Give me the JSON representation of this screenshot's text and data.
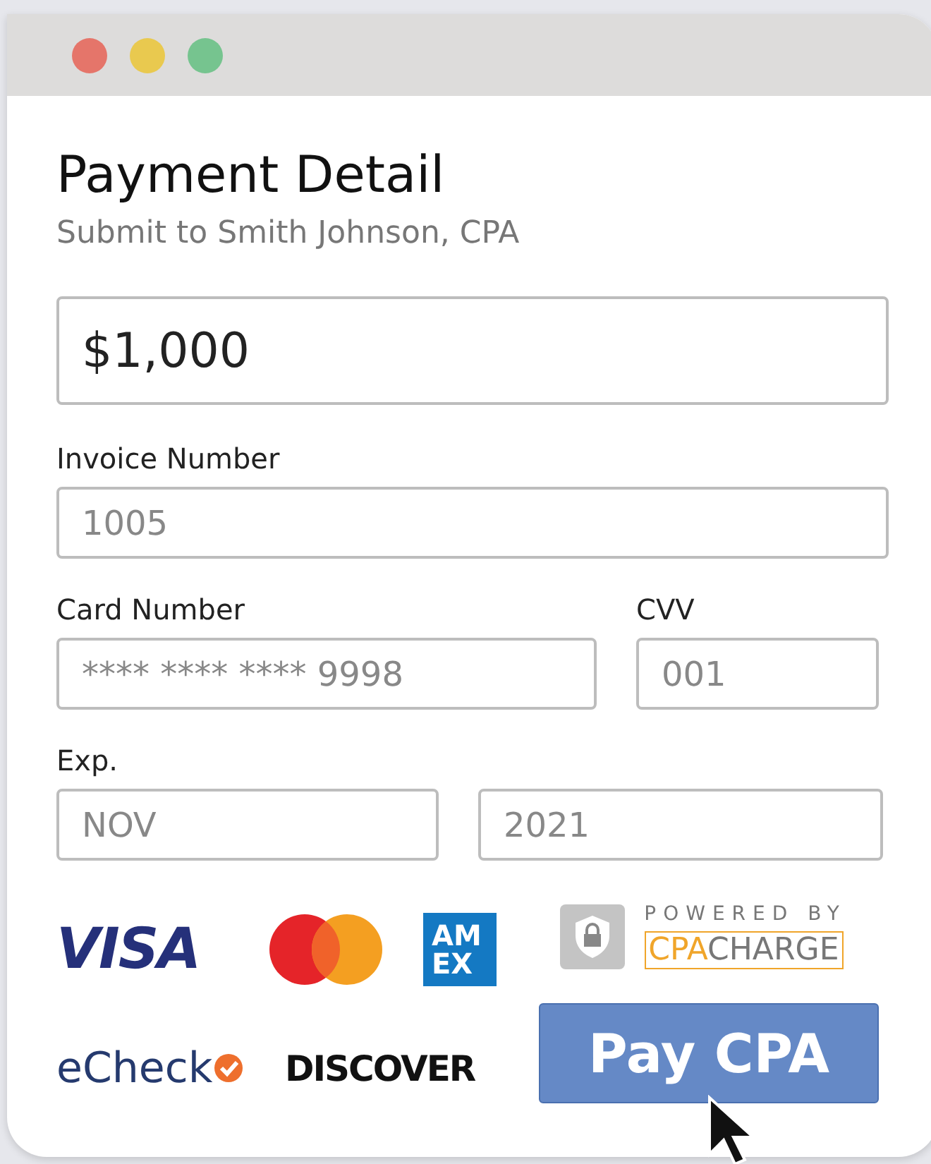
{
  "window": {
    "controls": [
      {
        "color": "#e5756a"
      },
      {
        "color": "#e9c94f"
      },
      {
        "color": "#76c48f"
      }
    ]
  },
  "title": "Payment Detail",
  "subtitle": "Submit to Smith Johnson, CPA",
  "amount": {
    "value": "$1,000"
  },
  "invoice": {
    "label": "Invoice Number",
    "value": "1005"
  },
  "card": {
    "label": "Card Number",
    "value": "**** **** **** 9998"
  },
  "cvv": {
    "label": "CVV",
    "value": "001"
  },
  "exp": {
    "label": "Exp.",
    "month": "NOV",
    "year": "2021"
  },
  "logos": {
    "visa": "VISA",
    "amex": [
      "AM",
      "EX"
    ],
    "echeck": "eCheck",
    "discover": "DISCOVER"
  },
  "powered": {
    "caption": "POWERED BY",
    "brand_a": "CPA",
    "brand_b": "CHARGE"
  },
  "pay_button": "Pay CPA"
}
